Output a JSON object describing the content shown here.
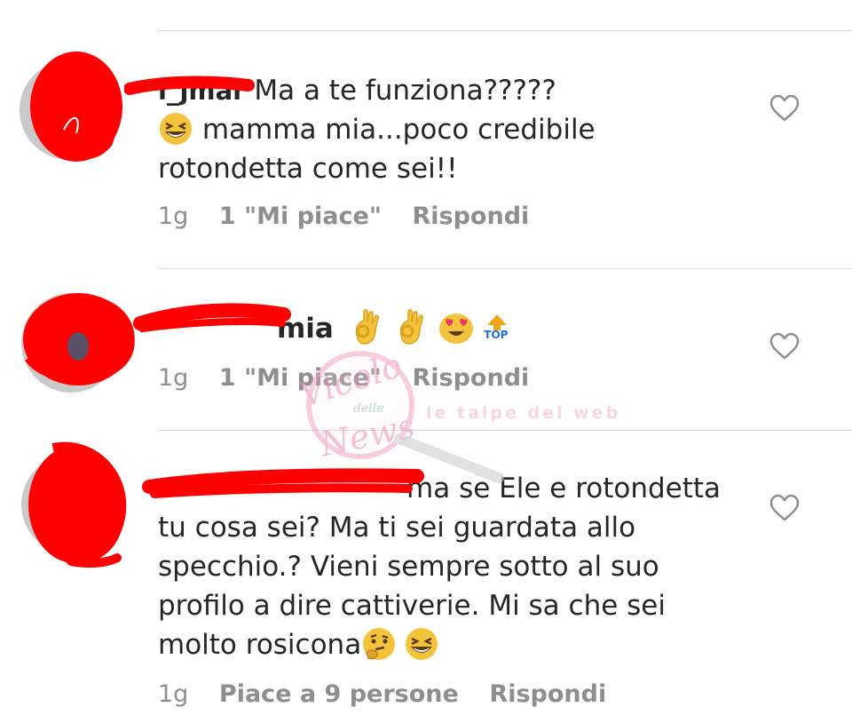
{
  "comments": [
    {
      "username": "l_jmar",
      "text_line1": "Ma a te funziona?????",
      "text_line2": "mamma mia...poco credibile",
      "text_line3": "rotondetta come sei!!",
      "emoji": "grinning-squinting-face",
      "time": "1g",
      "likes": "1 \"Mi piace\"",
      "reply": "Rispondi"
    },
    {
      "username": "mia",
      "emojis": [
        "ok-hand",
        "ok-hand",
        "heart-eyes-face",
        "top-arrow"
      ],
      "time": "1g",
      "likes": "1 \"Mi piace\"",
      "reply": "Rispondi"
    },
    {
      "username": "ma",
      "text_line1": "se Ele e rotondetta",
      "text_line2": "tu cosa sei? Ma ti sei guardata allo",
      "text_line3": "specchio.? Vieni sempre sotto al suo",
      "text_line4": "profilo a dire cattiverie. Mi sa che sei",
      "text_line5": "molto rosicona",
      "emojis": [
        "thinking-face",
        "grinning-squinting-face"
      ],
      "time": "1g",
      "likes": "Piace a 9 persone",
      "reply": "Rispondi"
    }
  ],
  "watermark": {
    "line1": "Vicolo",
    "line2": "delle",
    "line3": "News",
    "band": "le talpe del web"
  },
  "top_badge": "TOP",
  "colors": {
    "text": "#262626",
    "meta": "#8e8e8e",
    "divider": "#dbdbdb",
    "scribble": "#ff0000",
    "emoji_yellow": "#f5c33b"
  }
}
